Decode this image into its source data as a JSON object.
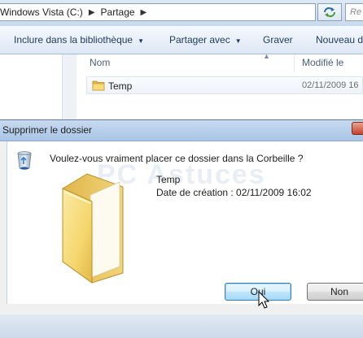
{
  "explorer": {
    "path": [
      "Windows Vista (C:)",
      "Partage"
    ],
    "search_placeholder": "Re",
    "toolbar": {
      "library_label": "Inclure dans la bibliothèque",
      "share_label": "Partager avec",
      "burn_label": "Graver",
      "new_label": "Nouveau d"
    },
    "columns": {
      "name": "Nom",
      "date": "Modifié le"
    },
    "files": [
      {
        "name": "Temp",
        "date": "02/11/2009 16"
      }
    ]
  },
  "dialog": {
    "title": "Supprimer le dossier",
    "question": "Voulez-vous vraiment placer ce dossier dans la Corbeille ?",
    "item_name": "Temp",
    "item_date": "Date de création : 02/11/2009 16:02",
    "yes_label": "Oui",
    "no_label": "Non",
    "watermark": "PC Astuces"
  },
  "colors": {
    "title_bar": "#a9c5e6",
    "close_button": "#c8422c",
    "default_button_border": "#3c7fb1",
    "folder_yellow": "#f5d76e"
  },
  "icons": [
    "folder-icon",
    "recycle-bin-icon",
    "refresh-icon",
    "mouse-cursor-icon",
    "sort-arrow-icon",
    "dropdown-arrow-icon"
  ]
}
